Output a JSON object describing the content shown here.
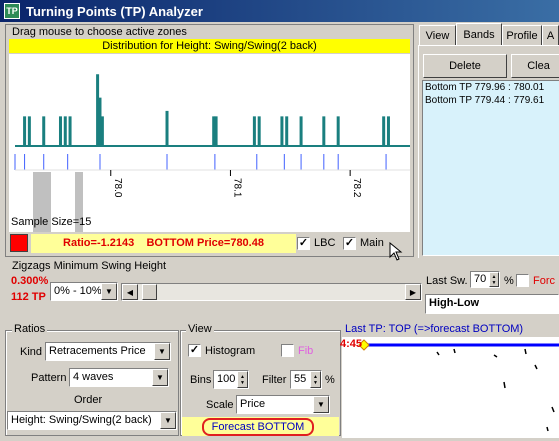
{
  "window": {
    "title": "Turning Points (TP) Analyzer",
    "icon_text": "TP"
  },
  "chart_panel": {
    "instruction": "Drag mouse to choose active zones",
    "header": "Distribution for Height: Swing/Swing(2 back)",
    "sample_size": "Sample Size=15",
    "ratio_text": "Ratio=-1.2143    BOTTOM Price=780.48",
    "lbc_label": "LBC",
    "lbc_checked": true,
    "main_label": "Main",
    "main_checked": true,
    "status_color": "#ff0000"
  },
  "chart_data": {
    "type": "bar",
    "title": "Distribution for Height: Swing/Swing(2 back)",
    "xlabel": "",
    "ylabel": "",
    "x_ticks": [
      "78.0",
      "78.1",
      "78.2"
    ],
    "x_tick_values": [
      78.0,
      78.1,
      78.2
    ],
    "xlim": [
      77.92,
      78.25
    ],
    "ylim": [
      0,
      1.0
    ],
    "bars": [
      {
        "x": 77.928,
        "h": 0.38
      },
      {
        "x": 77.932,
        "h": 0.38
      },
      {
        "x": 77.944,
        "h": 0.38
      },
      {
        "x": 77.958,
        "h": 0.38
      },
      {
        "x": 77.962,
        "h": 0.38
      },
      {
        "x": 77.966,
        "h": 0.38
      },
      {
        "x": 77.989,
        "h": 0.92
      },
      {
        "x": 77.991,
        "h": 0.62
      },
      {
        "x": 77.993,
        "h": 0.38
      },
      {
        "x": 78.047,
        "h": 0.45
      },
      {
        "x": 78.086,
        "h": 0.38
      },
      {
        "x": 78.088,
        "h": 0.38
      },
      {
        "x": 78.12,
        "h": 0.38
      },
      {
        "x": 78.124,
        "h": 0.38
      },
      {
        "x": 78.143,
        "h": 0.38
      },
      {
        "x": 78.147,
        "h": 0.38
      },
      {
        "x": 78.159,
        "h": 0.38
      },
      {
        "x": 78.178,
        "h": 0.38
      },
      {
        "x": 78.19,
        "h": 0.38
      },
      {
        "x": 78.228,
        "h": 0.38
      },
      {
        "x": 78.232,
        "h": 0.38
      }
    ],
    "zone_marks": [
      77.928,
      77.944,
      77.964,
      77.991,
      78.047,
      78.087,
      78.122,
      78.145,
      78.159,
      78.178,
      78.19,
      78.23
    ],
    "colors": {
      "bar": "#1a7f7f",
      "zone_mark": "#4060ff",
      "active_band": "#c0c0c0"
    }
  },
  "tabs": {
    "items": [
      "View",
      "Bands",
      "Profile",
      "A"
    ],
    "active": "Bands"
  },
  "bands": {
    "delete_label": "Delete",
    "clear_label": "Clea",
    "list": [
      "Bottom TP  779.96 : 780.01",
      "Bottom TP  779.44 : 779.61"
    ]
  },
  "zigzag": {
    "title": "Zigzags Minimum Swing Height",
    "percent_text": "0.300%",
    "tp_count": "112 TP",
    "range_value": "0% - 10%",
    "last_sw_label": "Last Sw.",
    "last_sw_value": "70",
    "percent_sign": "%",
    "force_label": "Forc",
    "mode_value": "High-Low"
  },
  "ratios": {
    "title": "Ratios",
    "kind_label": "Kind",
    "kind_value": "Retracements Price",
    "pattern_label": "Pattern",
    "pattern_value": "4 waves",
    "order_label": "Order",
    "order_value": "Height: Swing/Swing(2 back)"
  },
  "view": {
    "title": "View",
    "histogram_label": "Histogram",
    "histogram_checked": true,
    "fib_label": "Fib",
    "bins_label": "Bins",
    "bins_value": "100",
    "filter_label": "Filter",
    "filter_value": "55",
    "filter_unit": "%",
    "scale_label": "Scale",
    "scale_value": "Price",
    "forecast_label": "Forecast BOTTOM"
  },
  "lasttp": {
    "header": "Last TP: TOP (=>forecast BOTTOM)",
    "time_label": "4:45"
  }
}
